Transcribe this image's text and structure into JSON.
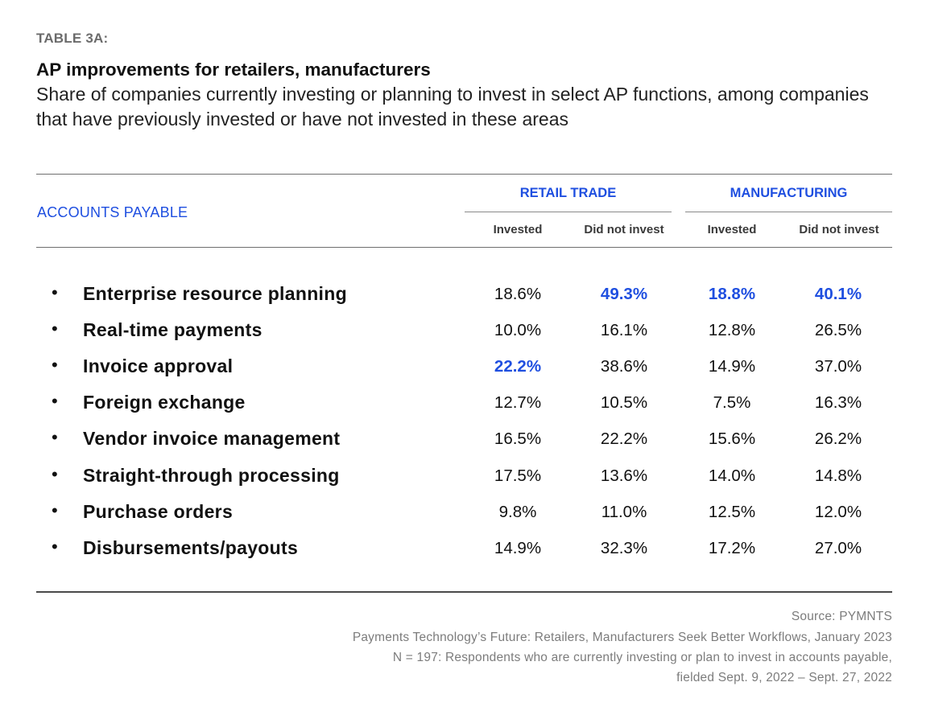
{
  "header": {
    "table_label": "TABLE 3A:",
    "title": "AP improvements for retailers, manufacturers",
    "subtitle": "Share of companies currently investing or planning to invest in select AP functions, among companies that have previously invested or have not invested in these areas"
  },
  "colors": {
    "accent": "#1f4fe0",
    "text": "#111111",
    "muted": "#7c7c7c",
    "rule": "#6e6e6e"
  },
  "chart_data": {
    "type": "table",
    "title": "AP improvements for retailers, manufacturers",
    "stub_header": "ACCOUNTS PAYABLE",
    "column_groups": [
      {
        "name": "RETAIL TRADE",
        "columns": [
          "Invested",
          "Did not invest"
        ]
      },
      {
        "name": "MANUFACTURING",
        "columns": [
          "Invested",
          "Did not invest"
        ]
      }
    ],
    "rows": [
      {
        "label": "Enterprise resource planning",
        "values": [
          "18.6%",
          "49.3%",
          "18.8%",
          "40.1%"
        ],
        "highlight": [
          false,
          true,
          true,
          true
        ]
      },
      {
        "label": "Real-time payments",
        "values": [
          "10.0%",
          "16.1%",
          "12.8%",
          "26.5%"
        ],
        "highlight": [
          false,
          false,
          false,
          false
        ]
      },
      {
        "label": "Invoice approval",
        "values": [
          "22.2%",
          "38.6%",
          "14.9%",
          "37.0%"
        ],
        "highlight": [
          true,
          false,
          false,
          false
        ]
      },
      {
        "label": "Foreign exchange",
        "values": [
          "12.7%",
          "10.5%",
          "7.5%",
          "16.3%"
        ],
        "highlight": [
          false,
          false,
          false,
          false
        ]
      },
      {
        "label": "Vendor invoice management",
        "values": [
          "16.5%",
          "22.2%",
          "15.6%",
          "26.2%"
        ],
        "highlight": [
          false,
          false,
          false,
          false
        ]
      },
      {
        "label": "Straight-through processing",
        "values": [
          "17.5%",
          "13.6%",
          "14.0%",
          "14.8%"
        ],
        "highlight": [
          false,
          false,
          false,
          false
        ]
      },
      {
        "label": "Purchase orders",
        "values": [
          "9.8%",
          "11.0%",
          "12.5%",
          "12.0%"
        ],
        "highlight": [
          false,
          false,
          false,
          false
        ]
      },
      {
        "label": "Disbursements/payouts",
        "values": [
          "14.9%",
          "32.3%",
          "17.2%",
          "27.0%"
        ],
        "highlight": [
          false,
          false,
          false,
          false
        ]
      }
    ],
    "bullet": "•"
  },
  "footer": {
    "source": "Source: PYMNTS",
    "report": "Payments Technology’s Future: Retailers, Manufacturers Seek Better Workflows, January 2023",
    "sample": "N = 197: Respondents who are currently investing or plan to invest in accounts payable,",
    "fielded": "fielded Sept. 9, 2022 – Sept. 27, 2022"
  }
}
